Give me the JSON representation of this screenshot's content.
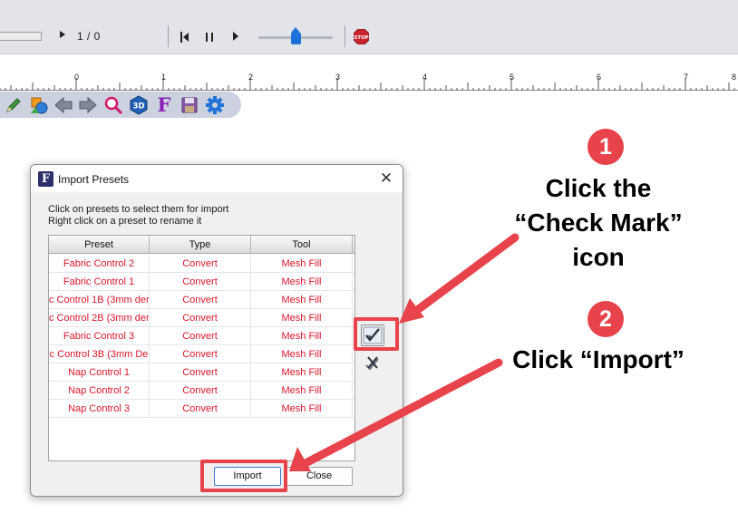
{
  "playbar": {
    "counter": "1 / 0"
  },
  "ruler": {
    "labels": [
      "0",
      "1",
      "2",
      "3",
      "4",
      "5",
      "6",
      "7",
      "8"
    ]
  },
  "toolbar": {
    "items": [
      "pencil-icon",
      "shapes-icon",
      "arrow-left-icon",
      "arrow-right-icon",
      "zoom-icon",
      "3d-icon",
      "f-icon",
      "save-icon",
      "gear-icon"
    ],
    "f_letter": "F",
    "threed_text": "3D"
  },
  "dialog": {
    "app_icon_letter": "F",
    "title": "Import Presets",
    "close_glyph": "✕",
    "instruction_1": "Click on presets to select them for import",
    "instruction_2": "Right click on a preset to rename it",
    "columns": [
      "Preset",
      "Type",
      "Tool"
    ],
    "rows": [
      [
        "Fabric Control 2",
        "Convert",
        "Mesh Fill"
      ],
      [
        "Fabric Control 1",
        "Convert",
        "Mesh Fill"
      ],
      [
        "c Control 1B (3mm der",
        "Convert",
        "Mesh Fill"
      ],
      [
        "c Control 2B (3mm der",
        "Convert",
        "Mesh Fill"
      ],
      [
        "Fabric Control 3",
        "Convert",
        "Mesh Fill"
      ],
      [
        "c Control 3B (3mm De",
        "Convert",
        "Mesh Fill"
      ],
      [
        "Nap Control 1",
        "Convert",
        "Mesh Fill"
      ],
      [
        "Nap Control 2",
        "Convert",
        "Mesh Fill"
      ],
      [
        "Nap Control 3",
        "Convert",
        "Mesh Fill"
      ]
    ],
    "import_label": "Import",
    "close_label": "Close"
  },
  "annotations": {
    "step1_number": "1",
    "step1_line1": "Click the",
    "step1_line2": "“Check Mark”",
    "step1_line3": "icon",
    "step2_number": "2",
    "step2_text": "Click “Import”"
  },
  "colors": {
    "accent": "#e8424b",
    "row_text": "#d8162a",
    "toolbar_bg": "#ccd1e0",
    "slider_thumb": "#1b72d9"
  }
}
